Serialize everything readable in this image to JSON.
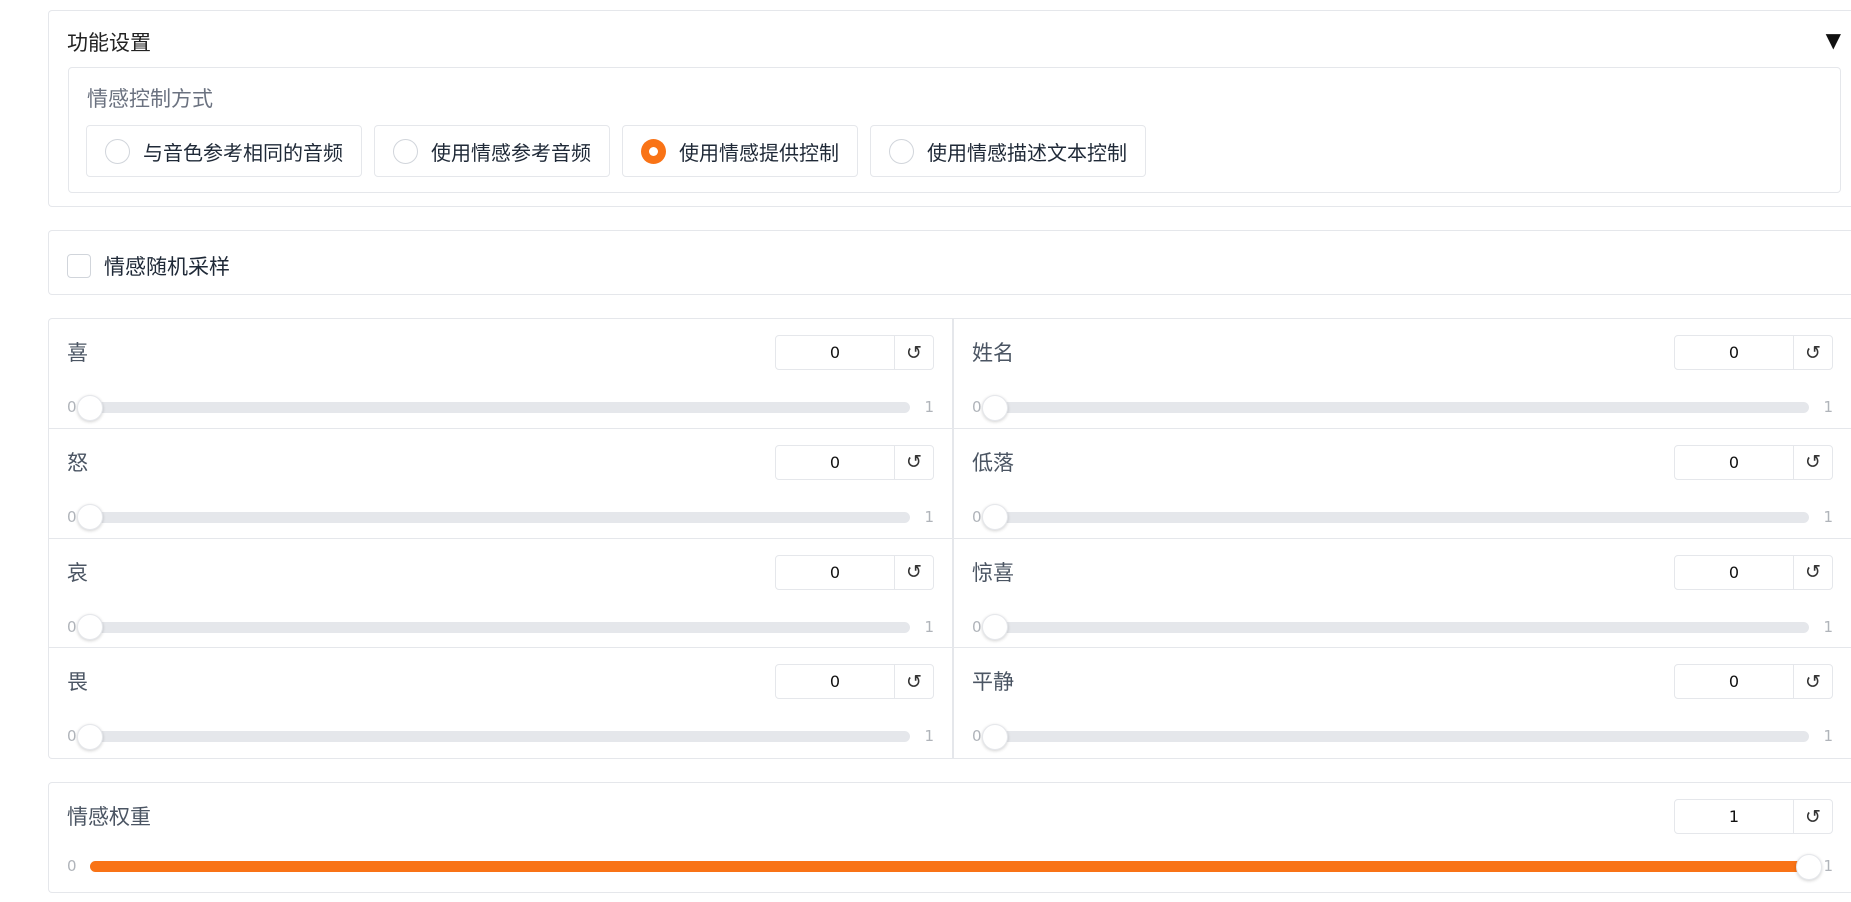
{
  "settings": {
    "title": "功能设置",
    "toggle_icon": "▼",
    "group_label": "情感控制方式",
    "options": [
      {
        "label": "与音色参考相同的音频",
        "selected": false
      },
      {
        "label": "使用情感参考音频",
        "selected": false
      },
      {
        "label": "使用情感提供控制",
        "selected": true
      },
      {
        "label": "使用情感描述文本控制",
        "selected": false
      }
    ]
  },
  "random_sampling": {
    "label": "情感随机采样",
    "checked": false
  },
  "emotions": [
    {
      "label": "喜",
      "value": 0,
      "min": 0,
      "max": 1
    },
    {
      "label": "姓名",
      "value": 0,
      "min": 0,
      "max": 1
    },
    {
      "label": "怒",
      "value": 0,
      "min": 0,
      "max": 1
    },
    {
      "label": "低落",
      "value": 0,
      "min": 0,
      "max": 1
    },
    {
      "label": "哀",
      "value": 0,
      "min": 0,
      "max": 1
    },
    {
      "label": "惊喜",
      "value": 0,
      "min": 0,
      "max": 1
    },
    {
      "label": "畏",
      "value": 0,
      "min": 0,
      "max": 1
    },
    {
      "label": "平静",
      "value": 0,
      "min": 0,
      "max": 1
    }
  ],
  "weight": {
    "label": "情感权重",
    "value": 1,
    "min": 0,
    "max": 1
  },
  "icons": {
    "reset": "↺",
    "reset_name": "reset-icon"
  },
  "colors": {
    "accent": "#f97316",
    "border": "#e5e7eb",
    "track": "#e5e7eb"
  }
}
